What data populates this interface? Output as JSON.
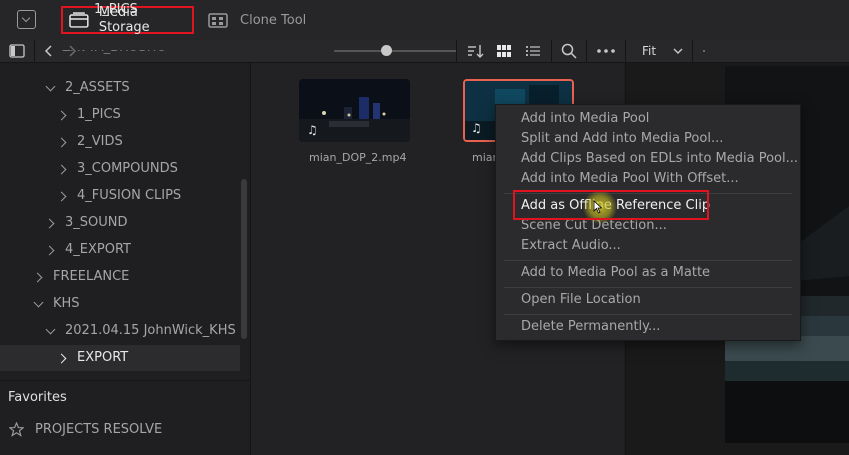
{
  "toolbar": {
    "media_storage_label": "Media Storage",
    "clone_tool_label": "Clone Tool"
  },
  "subbar": {
    "path_title": "1_PICS",
    "zoom_fit": "Fit"
  },
  "tree": {
    "items": [
      {
        "label": "2_ASSETS",
        "expanded": true
      },
      {
        "label": "1_PICS"
      },
      {
        "label": "2_VIDS"
      },
      {
        "label": "3_COMPOUNDS"
      },
      {
        "label": "4_FUSION CLIPS"
      },
      {
        "label": "3_SOUND"
      },
      {
        "label": "4_EXPORT"
      },
      {
        "label": "FREELANCE"
      },
      {
        "label": "KHS",
        "expanded": true
      },
      {
        "label": "2021.04.15 JohnWick_KHS",
        "expanded": true
      },
      {
        "label": "EXPORT",
        "selected": true
      }
    ]
  },
  "favorites": {
    "heading": "Favorites",
    "item": "PROJECTS RESOLVE"
  },
  "clips": [
    {
      "name": "mian_DOP_2.mp4"
    },
    {
      "name": "mian"
    }
  ],
  "context_menu": {
    "items": [
      "Add into Media Pool",
      "Split and Add into Media Pool...",
      "Add Clips Based on EDLs into Media Pool...",
      "Add into Media Pool With Offset...",
      "Add as Offline Reference Clip",
      "Scene Cut Detection...",
      "Extract Audio...",
      "Add to Media Pool as a Matte",
      "Open File Location",
      "Delete Permanently..."
    ]
  },
  "colors": {
    "highlight_red": "#e0141e",
    "selected_clip_border": "#e8624f"
  }
}
